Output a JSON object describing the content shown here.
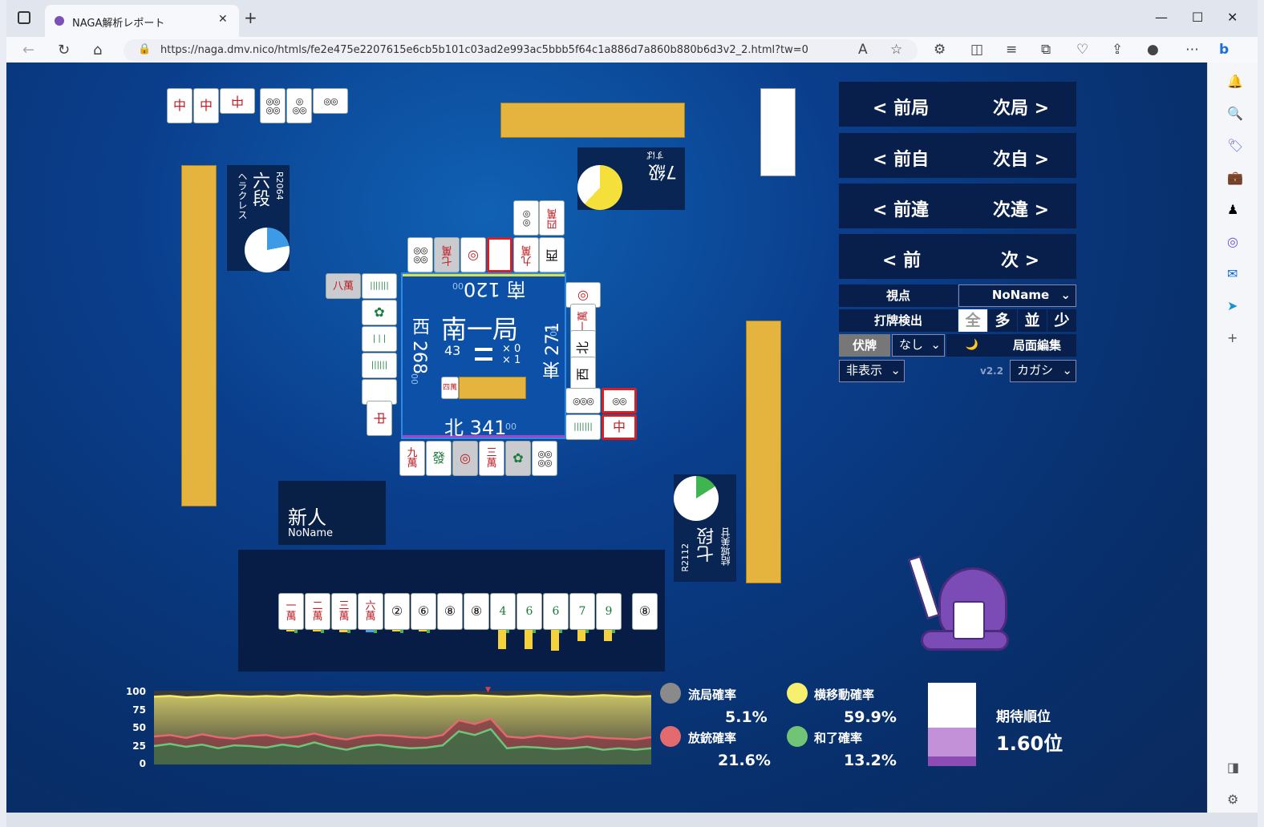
{
  "browser": {
    "tab_title": "NAGA解析レポート",
    "url": "https://naga.dmv.nico/htmls/fe2e475e2207615e6cb5b101c03ad2e993ac5bbb5f64c1a886d7a860b880b6d3v2_2.html?tw=0"
  },
  "nav": {
    "prev_round": "< 前局",
    "next_round": "次局 >",
    "prev_self": "< 前自",
    "next_self": "次自 >",
    "prev_diff": "< 前違",
    "next_diff": "次違 >",
    "prev": "< 前",
    "next": "次 >"
  },
  "options": {
    "viewpoint_label": "視点",
    "viewpoint_value": "NoName",
    "discard_detect_label": "打牌検出",
    "detect_all": "全",
    "detect_many": "多",
    "detect_mid": "並",
    "detect_few": "少",
    "hidden_label": "伏牌",
    "hidden_value": "なし",
    "moon": "🌙",
    "edit_label": "局面編集",
    "display_value": "非表示",
    "version": "v2.2",
    "font_value": "カガシ"
  },
  "round": {
    "name": "南一局",
    "remaining": "43",
    "honba": "× 0",
    "riichi": "× 1",
    "south_score": "南 120",
    "south_sub": "00",
    "west_score": "西 268",
    "west_sub": "00",
    "east_score": "東 271",
    "east_sub": "00",
    "north_score": "北 341",
    "north_sub": "00",
    "dora_label": "四萬"
  },
  "players": {
    "self": {
      "rank": "新人",
      "name": "NoName"
    },
    "left": {
      "rank": "六段",
      "name": "ヘラクレス",
      "rate": "R2064"
    },
    "top": {
      "rank": "7級",
      "name": "すば"
    },
    "right": {
      "rank": "七段",
      "name": "結城美甘",
      "rate": "R2112"
    }
  },
  "hand": [
    "一萬",
    "二萬",
    "三萬",
    "六萬",
    "②",
    "⑥",
    "⑧",
    "⑧",
    "4",
    "6",
    "6",
    "7",
    "9",
    "⑧"
  ],
  "chart": {
    "y_ticks": [
      "100",
      "75",
      "50",
      "25",
      "0"
    ]
  },
  "chart_data": {
    "type": "area",
    "ylim": [
      0,
      100
    ],
    "series": [
      {
        "name": "横移動確率",
        "color": "#f6e86a",
        "values": [
          92,
          93,
          91,
          92,
          94,
          93,
          92,
          93,
          92,
          94,
          93,
          92,
          93,
          92,
          93,
          94,
          93,
          92,
          93,
          93,
          94,
          93,
          92,
          93,
          94,
          93,
          92,
          93,
          94,
          93,
          92,
          93
        ]
      },
      {
        "name": "放銃確率",
        "color": "#e06a70",
        "values": [
          38,
          40,
          36,
          41,
          37,
          35,
          39,
          40,
          36,
          38,
          42,
          37,
          34,
          38,
          40,
          39,
          37,
          36,
          40,
          60,
          55,
          62,
          38,
          36,
          39,
          37,
          35,
          38,
          36,
          35,
          34,
          37
        ]
      },
      {
        "name": "和了確率",
        "color": "#6cc57a",
        "values": [
          25,
          28,
          24,
          27,
          22,
          26,
          25,
          23,
          27,
          24,
          30,
          24,
          20,
          25,
          27,
          24,
          22,
          23,
          26,
          45,
          40,
          48,
          22,
          24,
          23,
          21,
          22,
          24,
          20,
          22,
          20,
          22
        ]
      }
    ]
  },
  "stats": {
    "ryukyoku_label": "流局確率",
    "ryukyoku_value": "5.1%",
    "yoko_label": "横移動確率",
    "yoko_value": "59.9%",
    "houju_label": "放銃確率",
    "houju_value": "21.6%",
    "agari_label": "和了確率",
    "agari_value": "13.2%",
    "expected_label": "期待順位",
    "expected_value": "1.60位",
    "colors": {
      "ryukyoku": "#8a8a8a",
      "yoko": "#f7ef6e",
      "houju": "#e36b70",
      "agari": "#71c476"
    }
  }
}
